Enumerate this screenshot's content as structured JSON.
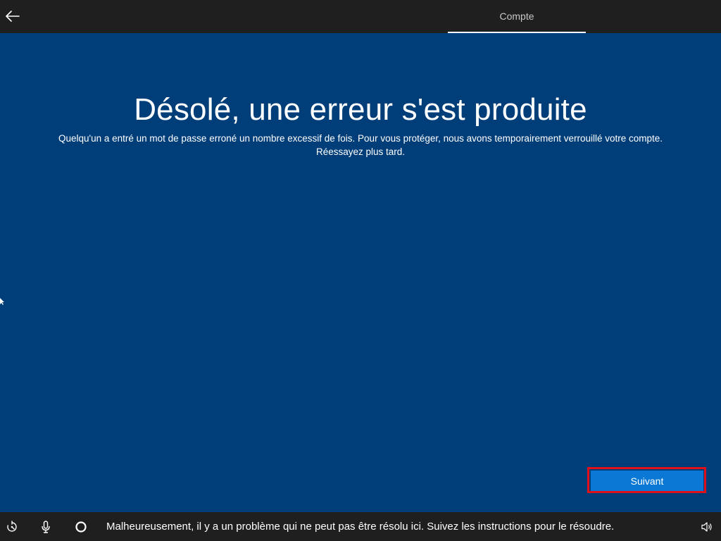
{
  "header": {
    "tab_label": "Compte"
  },
  "main": {
    "title": "Désolé, une erreur s'est produite",
    "message": "Quelqu'un a entré un mot de passe erroné un nombre excessif de fois. Pour vous protéger, nous avons temporairement verrouillé votre compte. Réessayez plus tard.",
    "next_button_label": "Suivant"
  },
  "bottom_bar": {
    "status_message": "Malheureusement, il y a un problème qui ne peut pas être résolu ici. Suivez les instructions pour le résoudre.",
    "icons": [
      "accessibility-icon",
      "microphone-icon",
      "cortana-icon",
      "volume-icon"
    ]
  },
  "colors": {
    "background": "#003e7a",
    "chrome": "#1f1f1f",
    "accent": "#0a78d4",
    "highlight": "#e0101a"
  }
}
